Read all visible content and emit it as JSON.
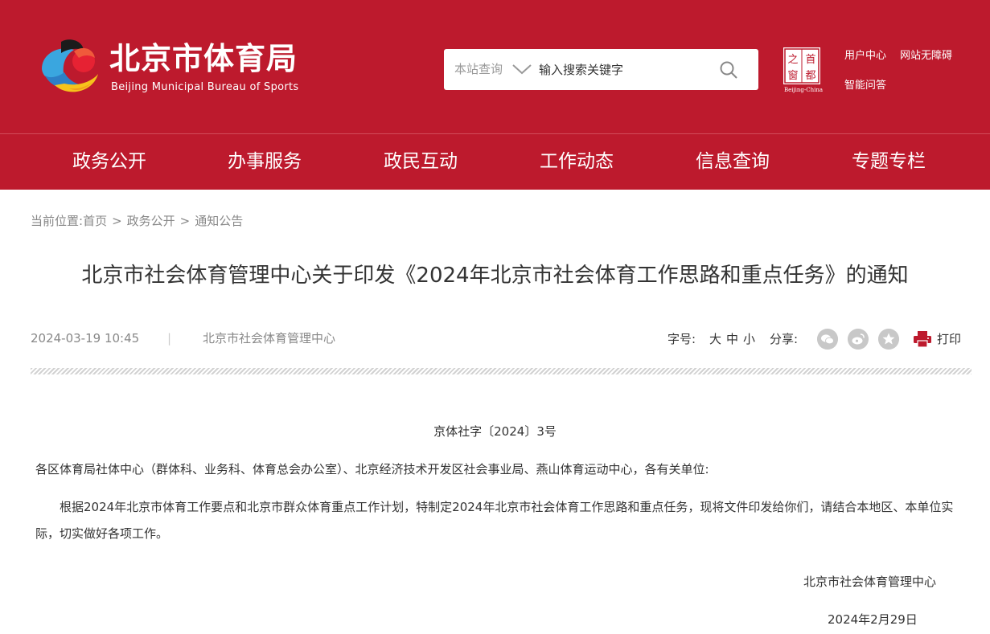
{
  "header": {
    "logo_cn": "北京市体育局",
    "logo_en": "Beijing Municipal Bureau of Sports",
    "search": {
      "scope_label": "本站查询",
      "placeholder": "输入搜索关键字"
    },
    "seal": {
      "chars": [
        "之",
        "首",
        "窗",
        "都"
      ],
      "caption": "Beijing-China"
    },
    "links": {
      "user_center": "用户中心",
      "accessibility": "网站无障碍",
      "smart_qa": "智能问答"
    },
    "colors": {
      "brand": "#bd1a2d"
    }
  },
  "nav": {
    "items": [
      "政务公开",
      "办事服务",
      "政民互动",
      "工作动态",
      "信息查询",
      "专题专栏"
    ]
  },
  "breadcrumb": {
    "prefix": "当前位置:",
    "items": [
      "首页",
      "政务公开",
      "通知公告"
    ],
    "separator": ">"
  },
  "article": {
    "title": "北京市社会体育管理中心关于印发《2024年北京市社会体育工作思路和重点任务》的通知",
    "date": "2024-03-19 10:45",
    "divider": "|",
    "source": "北京市社会体育管理中心",
    "tools": {
      "font_size_label": "字号:",
      "font_sizes": [
        "大",
        "中",
        "小"
      ],
      "share_label": "分享:",
      "share_icons": [
        "wechat-icon",
        "weibo-icon",
        "favorite-icon"
      ],
      "print_label": "打印"
    },
    "doc_number": "京体社字〔2024〕3号",
    "salutation": "各区体育局社体中心（群体科、业务科、体育总会办公室）、北京经济技术开发区社会事业局、燕山体育运动中心，各有关单位:",
    "body": "根据2024年北京市体育工作要点和北京市群众体育重点工作计划，特制定2024年北京市社会体育工作思路和重点任务，现将文件印发给你们，请结合本地区、本单位实际，切实做好各项工作。",
    "signature": "北京市社会体育管理中心",
    "sign_date": "2024年2月29日"
  }
}
